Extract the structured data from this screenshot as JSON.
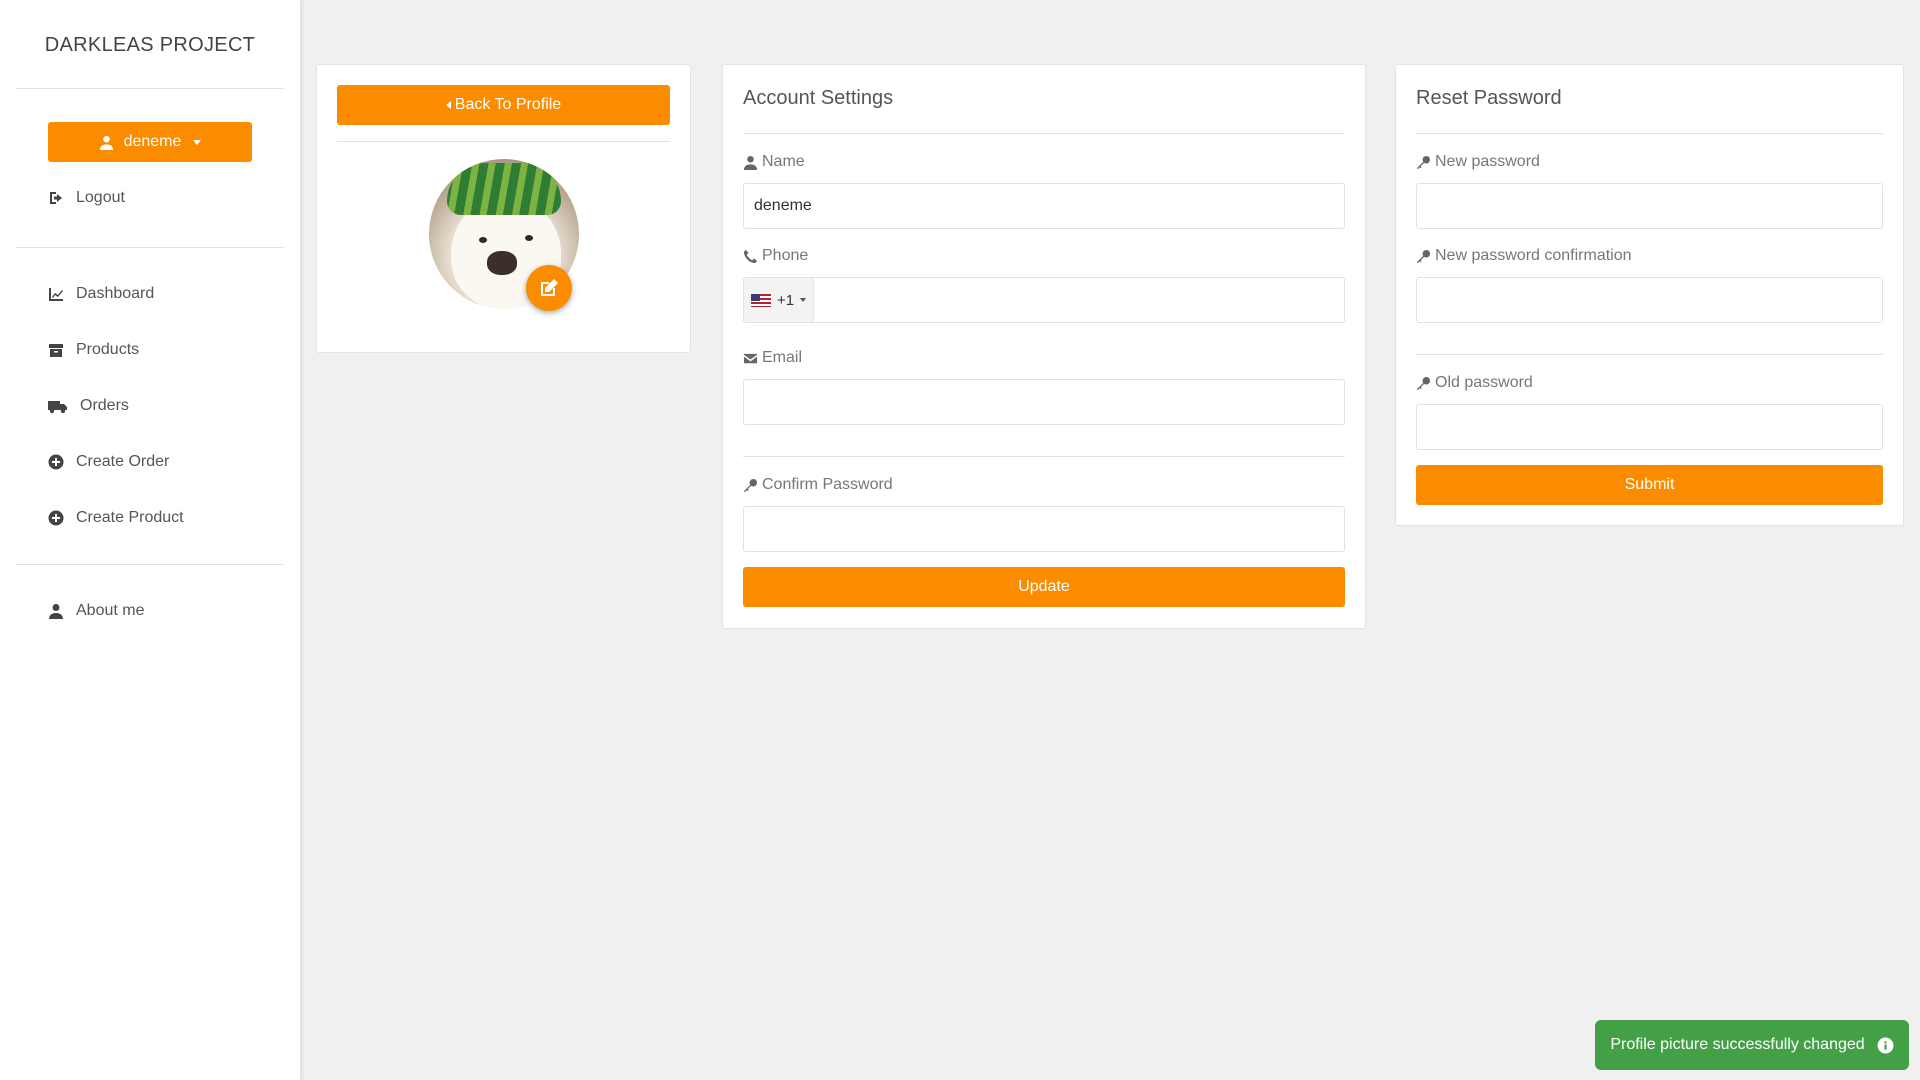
{
  "sidebar": {
    "brand": "DARKLEAS PROJECT",
    "user_menu": {
      "label": "deneme"
    },
    "logout": "Logout",
    "nav": [
      {
        "label": "Dashboard",
        "icon": "chart-icon"
      },
      {
        "label": "Products",
        "icon": "archive-icon"
      },
      {
        "label": "Orders",
        "icon": "truck-icon"
      },
      {
        "label": "Create Order",
        "icon": "plus-circle-icon"
      },
      {
        "label": "Create Product",
        "icon": "plus-circle-icon"
      }
    ],
    "about": "About me"
  },
  "profile_card": {
    "back_label": "Back To Profile",
    "avatar_alt": "profile picture"
  },
  "account_settings": {
    "title": "Account Settings",
    "name_label": "Name",
    "name_value": "deneme",
    "phone_label": "Phone",
    "phone_code": "+1",
    "phone_value": "",
    "email_label": "Email",
    "email_value": "",
    "confirm_label": "Confirm Password",
    "confirm_value": "",
    "update_label": "Update"
  },
  "reset_password": {
    "title": "Reset Password",
    "new_label": "New password",
    "new_value": "",
    "confirm_label": "New password confirmation",
    "confirm_value": "",
    "old_label": "Old password",
    "old_value": "",
    "submit_label": "Submit"
  },
  "toast": {
    "message": "Profile picture successfully changed",
    "color": "#43a047"
  },
  "colors": {
    "accent": "#fb8c00",
    "background": "#f0f0f0"
  }
}
